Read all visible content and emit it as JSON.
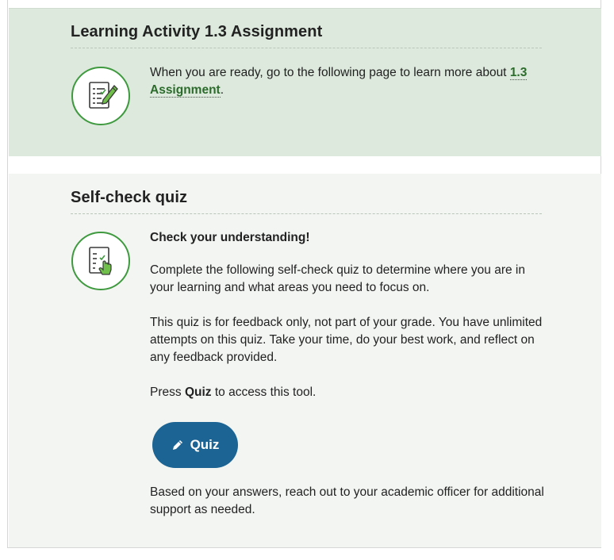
{
  "activity": {
    "title": "Learning Activity 1.3 Assignment",
    "text_before": "When you are ready, go to the following page to learn more about ",
    "link_label_line1": "1.3",
    "link_label_line2": "Assignment",
    "text_after": ".",
    "icon": "checklist-pencil-icon"
  },
  "quiz_section": {
    "title": "Self-check quiz",
    "icon": "checklist-pointer-icon",
    "subheading": "Check your understanding!",
    "para1": "Complete the following self-check quiz to determine where you are in your learning and what areas you need to focus on.",
    "para2": "This quiz is for feedback only, not part of your grade. You have unlimited attempts on this quiz. Take your time, do your best work, and reflect on any feedback provided.",
    "para3_before": "Press ",
    "para3_bold": "Quiz",
    "para3_after": " to access this tool.",
    "button_label": "Quiz",
    "button_icon": "pencil-icon",
    "para4": "Based on your answers, reach out to your academic officer for additional support as needed."
  },
  "colors": {
    "panel_green": "#dce9dc",
    "panel_light": "#f2f5f2",
    "icon_green": "#3f9a3f",
    "link_green": "#2b6b2b",
    "button_blue": "#1b6493"
  }
}
